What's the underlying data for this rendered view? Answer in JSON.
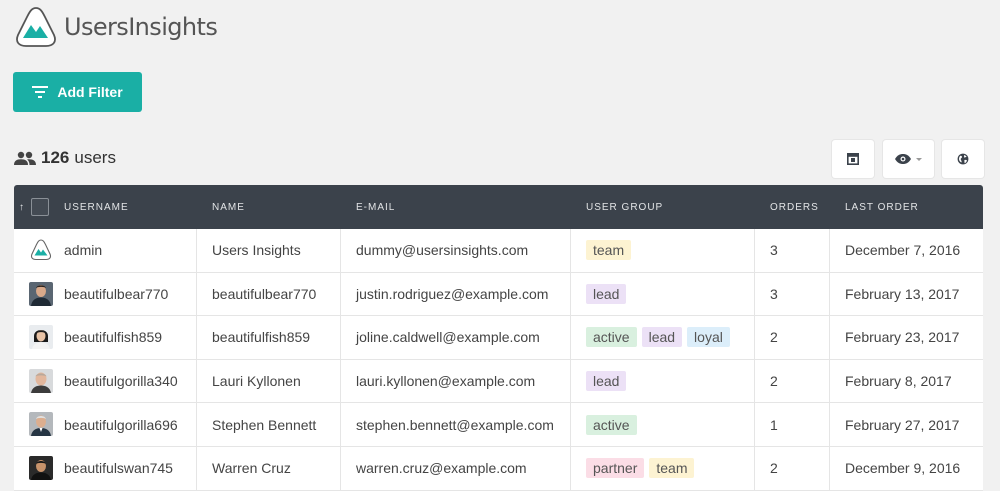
{
  "app": {
    "name": "UsersInsights"
  },
  "toolbar": {
    "add_filter_label": "Add Filter"
  },
  "summary": {
    "count": "126",
    "unit": "users"
  },
  "table": {
    "sort_indicator": "↑",
    "headers": {
      "username": "USERNAME",
      "name": "NAME",
      "email": "E-MAIL",
      "group": "USER GROUP",
      "orders": "ORDERS",
      "last_order": "LAST ORDER"
    },
    "rows": [
      {
        "username": "admin",
        "name": "Users Insights",
        "email": "dummy@usersinsights.com",
        "groups": [
          "team"
        ],
        "orders": "3",
        "last_order": "December 7, 2016"
      },
      {
        "username": "beautifulbear770",
        "name": "beautifulbear770",
        "email": "justin.rodriguez@example.com",
        "groups": [
          "lead"
        ],
        "orders": "3",
        "last_order": "February 13, 2017"
      },
      {
        "username": "beautifulfish859",
        "name": "beautifulfish859",
        "email": "joline.caldwell@example.com",
        "groups": [
          "active",
          "lead",
          "loyal"
        ],
        "orders": "2",
        "last_order": "February 23, 2017"
      },
      {
        "username": "beautifulgorilla340",
        "name": "Lauri Kyllonen",
        "email": "lauri.kyllonen@example.com",
        "groups": [
          "lead"
        ],
        "orders": "2",
        "last_order": "February 8, 2017"
      },
      {
        "username": "beautifulgorilla696",
        "name": "Stephen Bennett",
        "email": "stephen.bennett@example.com",
        "groups": [
          "active"
        ],
        "orders": "1",
        "last_order": "February 27, 2017"
      },
      {
        "username": "beautifulswan745",
        "name": "Warren Cruz",
        "email": "warren.cruz@example.com",
        "groups": [
          "partner",
          "team"
        ],
        "orders": "2",
        "last_order": "December 9, 2016"
      }
    ]
  },
  "tag_colors": {
    "team": {
      "bg": "#fdf3d2",
      "fg": "#555555"
    },
    "lead": {
      "bg": "#ece1f6",
      "fg": "#555555"
    },
    "active": {
      "bg": "#d9f0df",
      "fg": "#555555"
    },
    "loyal": {
      "bg": "#dceefa",
      "fg": "#555555"
    },
    "partner": {
      "bg": "#fbdde6",
      "fg": "#555555"
    }
  },
  "colors": {
    "accent": "#1aafa5",
    "header_bg": "#3b424b"
  },
  "icons": {
    "layout": "layout-icon",
    "visibility": "eye-icon",
    "map": "globe-icon",
    "users": "users-icon"
  }
}
